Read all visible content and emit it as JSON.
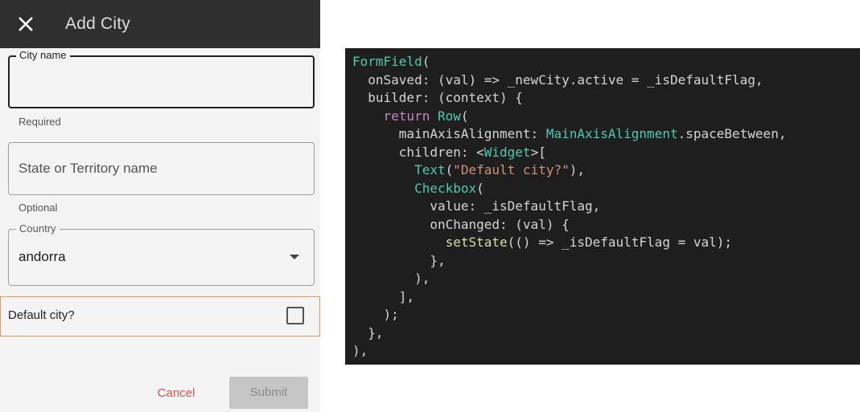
{
  "app_bar": {
    "close_icon": "close-icon",
    "title": "Add City"
  },
  "form": {
    "city_name": {
      "label": "City name",
      "value": "",
      "helper": "Required"
    },
    "state": {
      "placeholder": "State or Territory name",
      "helper": "Optional"
    },
    "country": {
      "label": "Country",
      "value": "andorra",
      "dropdown_icon": "arrow-drop-down-icon"
    },
    "default_city": {
      "label": "Default city?",
      "checked": false
    }
  },
  "actions": {
    "cancel_label": "Cancel",
    "submit_label": "Submit"
  },
  "colors": {
    "app_bar": "#2f2f2f",
    "cancel_text": "#d9534f",
    "submit_disabled_bg": "#c6c6c6",
    "default_row_border": "#e49a5c",
    "code_bg": "#1e1e1e"
  },
  "code": {
    "language": "dart",
    "lines": [
      [
        {
          "t": "FormField",
          "c": "ty"
        },
        {
          "t": "("
        }
      ],
      [
        {
          "t": "  onSaved: (val) => _newCity.active = _isDefaultFlag,"
        }
      ],
      [
        {
          "t": "  builder: (context) {"
        }
      ],
      [
        {
          "t": "    "
        },
        {
          "t": "return",
          "c": "kw"
        },
        {
          "t": " "
        },
        {
          "t": "Row",
          "c": "ty"
        },
        {
          "t": "("
        }
      ],
      [
        {
          "t": "      mainAxisAlignment: "
        },
        {
          "t": "MainAxisAlignment",
          "c": "ty"
        },
        {
          "t": ".spaceBetween,"
        }
      ],
      [
        {
          "t": "      children: <"
        },
        {
          "t": "Widget",
          "c": "ty"
        },
        {
          "t": ">["
        }
      ],
      [
        {
          "t": "        "
        },
        {
          "t": "Text",
          "c": "ty"
        },
        {
          "t": "("
        },
        {
          "t": "\"Default city?\"",
          "c": "str"
        },
        {
          "t": "),"
        }
      ],
      [
        {
          "t": "        "
        },
        {
          "t": "Checkbox",
          "c": "ty"
        },
        {
          "t": "("
        }
      ],
      [
        {
          "t": "          value: _isDefaultFlag,"
        }
      ],
      [
        {
          "t": "          onChanged: (val) {"
        }
      ],
      [
        {
          "t": "            "
        },
        {
          "t": "setState",
          "c": "fn"
        },
        {
          "t": "(() => _isDefaultFlag = val);"
        }
      ],
      [
        {
          "t": "          },"
        }
      ],
      [
        {
          "t": "        ),"
        }
      ],
      [
        {
          "t": "      ],"
        }
      ],
      [
        {
          "t": "    );"
        }
      ],
      [
        {
          "t": "  },"
        }
      ],
      [
        {
          "t": "),"
        }
      ]
    ]
  }
}
